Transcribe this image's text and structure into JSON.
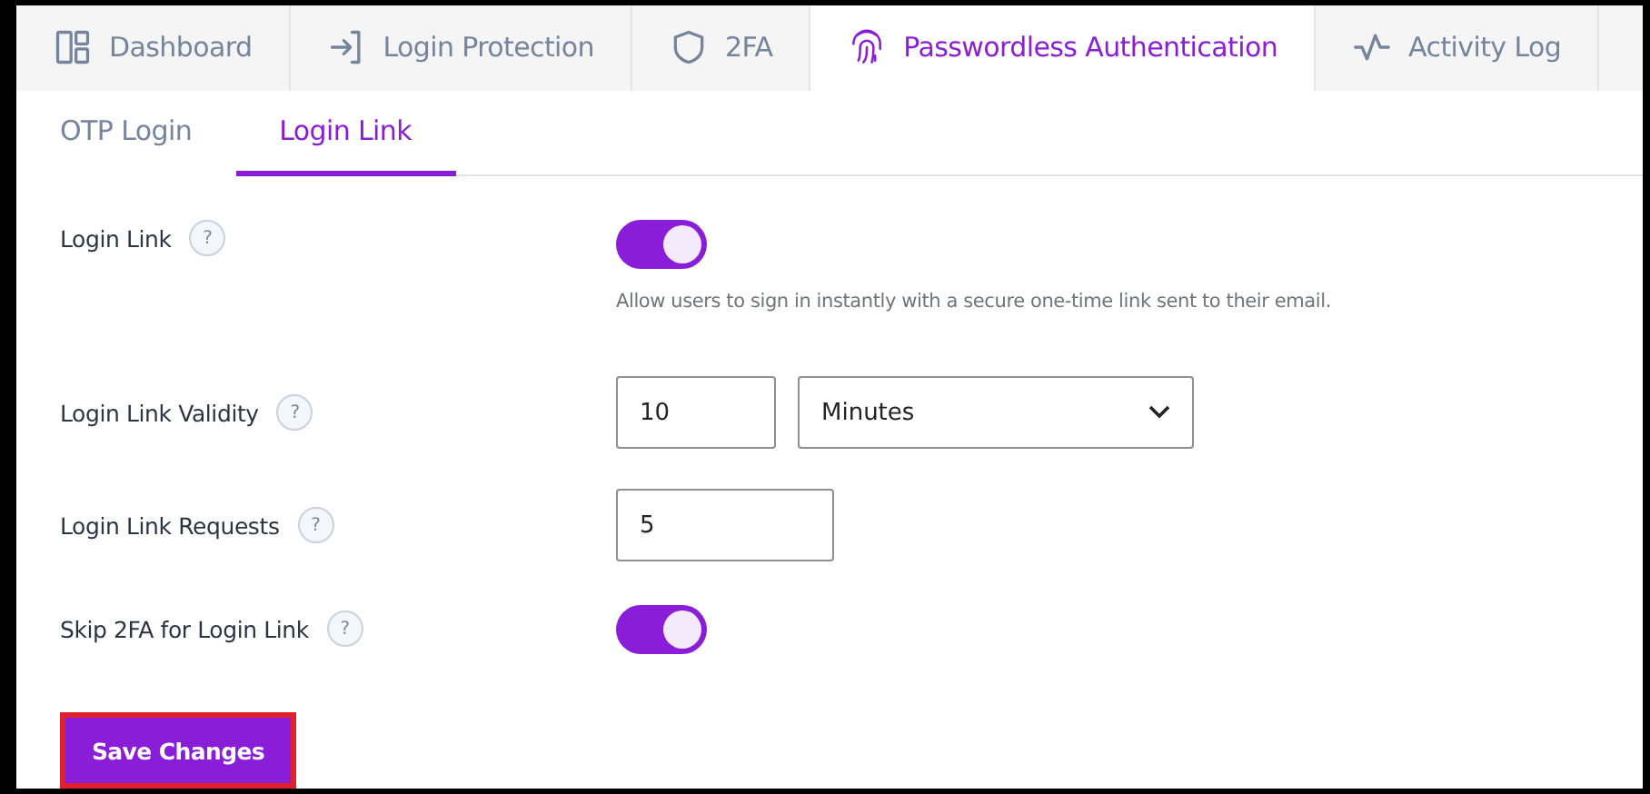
{
  "tabs": [
    {
      "label": "Dashboard",
      "selected": false
    },
    {
      "label": "Login Protection",
      "selected": false
    },
    {
      "label": "2FA",
      "selected": false
    },
    {
      "label": "Passwordless Authentication",
      "selected": true
    },
    {
      "label": "Activity Log",
      "selected": false
    }
  ],
  "subtabs": [
    {
      "label": "OTP Login",
      "selected": false
    },
    {
      "label": "Login Link",
      "selected": true
    }
  ],
  "settings": [
    {
      "kind": "toggle",
      "label": "Login Link",
      "help": "?",
      "on": true,
      "description": "Allow users to sign in instantly with a secure one-time link sent to their email."
    },
    {
      "kind": "number_select",
      "label": "Login Link Validity",
      "help": "?",
      "value": "10",
      "unit": "Minutes"
    },
    {
      "kind": "number",
      "label": "Login Link Requests",
      "help": "?",
      "value": "5"
    },
    {
      "kind": "toggle",
      "label": "Skip 2FA for Login Link",
      "help": "?",
      "on": true
    }
  ],
  "save_button": "Save Changes"
}
